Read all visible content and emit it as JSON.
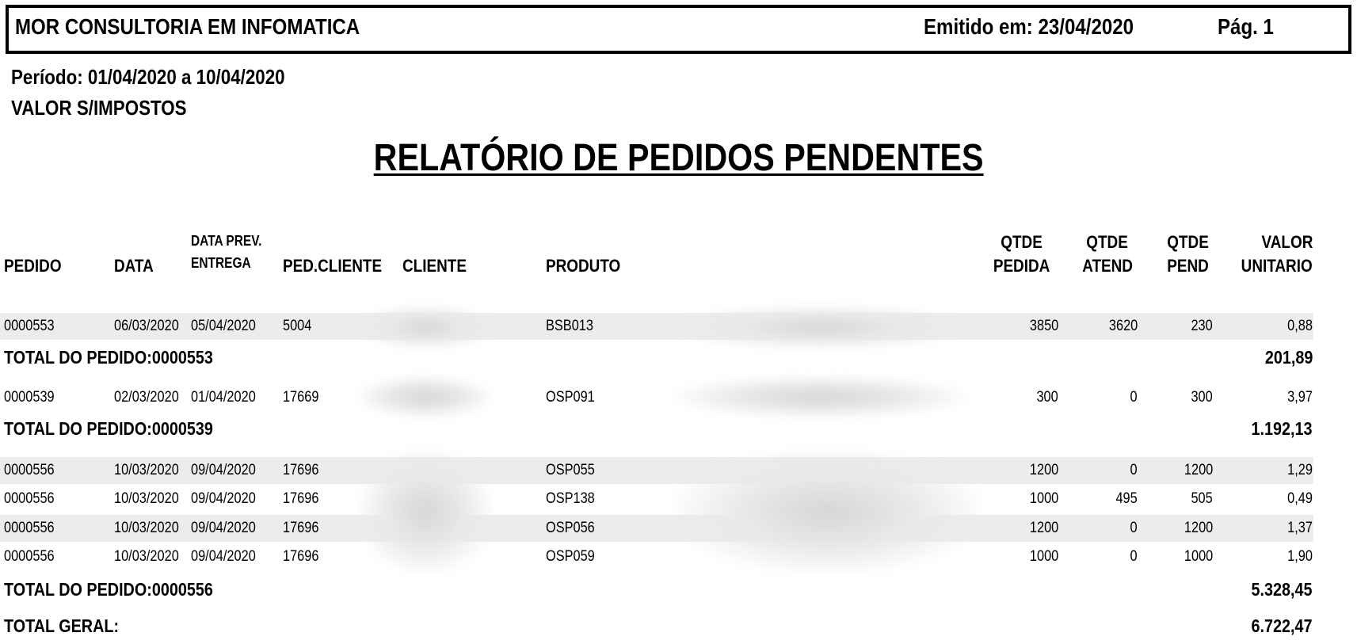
{
  "header": {
    "company": "MOR CONSULTORIA EM INFOMATICA",
    "issued": "Emitido em: 23/04/2020",
    "page": "Pág. 1"
  },
  "meta": {
    "period": "Período: 01/04/2020 a 10/04/2020",
    "value_note": "VALOR S/IMPOSTOS"
  },
  "title": "RELATÓRIO DE PEDIDOS PENDENTES",
  "columns": {
    "pedido": "PEDIDO",
    "data": "DATA",
    "data_prev_1": "DATA PREV.",
    "data_prev_2": "ENTREGA",
    "ped_cliente": "PED.CLIENTE",
    "cliente": "CLIENTE",
    "produto": "PRODUTO",
    "qtde_pedida_1": "QTDE",
    "qtde_pedida_2": "PEDIDA",
    "qtde_atend_1": "QTDE",
    "qtde_atend_2": "ATEND",
    "qtde_pend_1": "QTDE",
    "qtde_pend_2": "PEND",
    "valor_1": "VALOR",
    "valor_2": "UNITARIO"
  },
  "rows": [
    {
      "pedido": "0000553",
      "data": "06/03/2020",
      "entrega": "05/04/2020",
      "ped_cliente": "5004",
      "produto": "BSB013",
      "qtde_pedida": "3850",
      "qtde_atend": "3620",
      "qtde_pend": "230",
      "valor": "0,88"
    },
    {
      "pedido": "0000539",
      "data": "02/03/2020",
      "entrega": "01/04/2020",
      "ped_cliente": "17669",
      "produto": "OSP091",
      "qtde_pedida": "300",
      "qtde_atend": "0",
      "qtde_pend": "300",
      "valor": "3,97"
    },
    {
      "pedido": "0000556",
      "data": "10/03/2020",
      "entrega": "09/04/2020",
      "ped_cliente": "17696",
      "produto": "OSP055",
      "qtde_pedida": "1200",
      "qtde_atend": "0",
      "qtde_pend": "1200",
      "valor": "1,29"
    },
    {
      "pedido": "0000556",
      "data": "10/03/2020",
      "entrega": "09/04/2020",
      "ped_cliente": "17696",
      "produto": "OSP138",
      "qtde_pedida": "1000",
      "qtde_atend": "495",
      "qtde_pend": "505",
      "valor": "0,49"
    },
    {
      "pedido": "0000556",
      "data": "10/03/2020",
      "entrega": "09/04/2020",
      "ped_cliente": "17696",
      "produto": "OSP056",
      "qtde_pedida": "1200",
      "qtde_atend": "0",
      "qtde_pend": "1200",
      "valor": "1,37"
    },
    {
      "pedido": "0000556",
      "data": "10/03/2020",
      "entrega": "09/04/2020",
      "ped_cliente": "17696",
      "produto": "OSP059",
      "qtde_pedida": "1000",
      "qtde_atend": "0",
      "qtde_pend": "1000",
      "valor": "1,90"
    }
  ],
  "totals": [
    {
      "label": "TOTAL DO PEDIDO:0000553",
      "value": "201,89"
    },
    {
      "label": "TOTAL DO PEDIDO:0000539",
      "value": "1.192,13"
    },
    {
      "label": "TOTAL DO PEDIDO:0000556",
      "value": "5.328,45"
    }
  ],
  "grand_total": {
    "label": "TOTAL GERAL:",
    "value": "6.722,47"
  }
}
